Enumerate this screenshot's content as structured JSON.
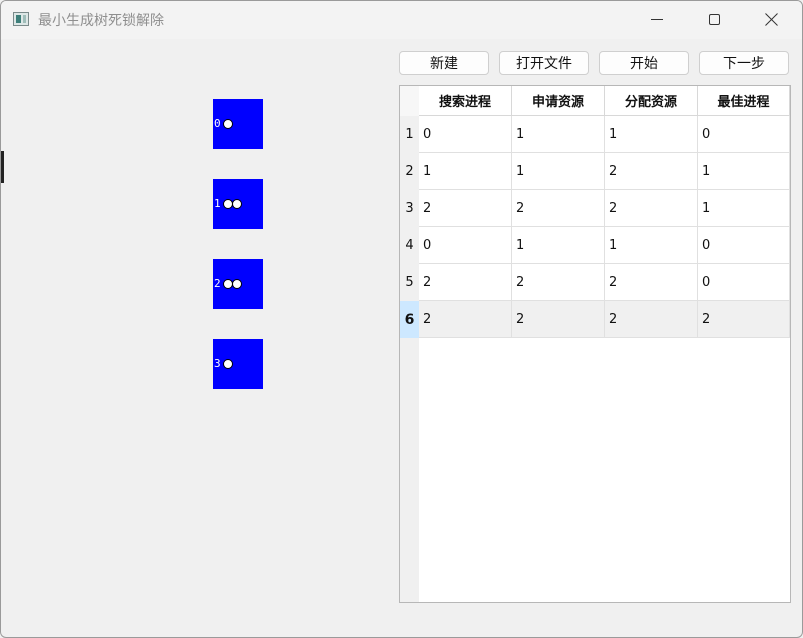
{
  "window": {
    "title": "最小生成树死锁解除"
  },
  "processes": [
    {
      "label": "0",
      "tokens": 1
    },
    {
      "label": "1",
      "tokens": 2
    },
    {
      "label": "2",
      "tokens": 2
    },
    {
      "label": "3",
      "tokens": 1
    }
  ],
  "toolbar": {
    "new_label": "新建",
    "open_label": "打开文件",
    "start_label": "开始",
    "next_label": "下一步"
  },
  "table": {
    "columns": [
      "搜索进程",
      "申请资源",
      "分配资源",
      "最佳进程"
    ],
    "row_numbers": [
      "1",
      "2",
      "3",
      "4",
      "5",
      "6"
    ],
    "rows": [
      [
        "0",
        "1",
        "1",
        "0"
      ],
      [
        "1",
        "1",
        "2",
        "1"
      ],
      [
        "2",
        "2",
        "2",
        "1"
      ],
      [
        "0",
        "1",
        "1",
        "0"
      ],
      [
        "2",
        "2",
        "2",
        "0"
      ],
      [
        "2",
        "2",
        "2",
        "2"
      ]
    ],
    "selected_row": 6
  },
  "colors": {
    "process_fill": "#0000ff",
    "selected_row_header": "#cde8ff"
  }
}
